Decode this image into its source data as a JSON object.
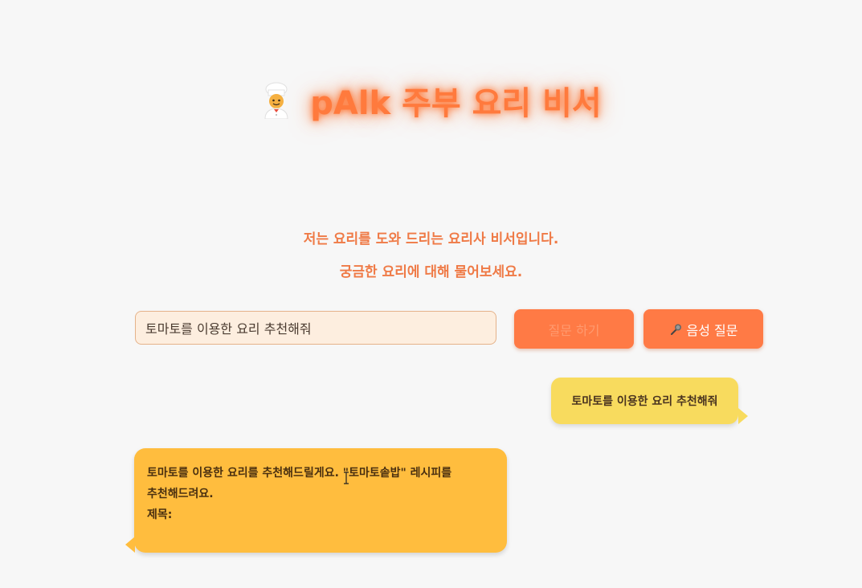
{
  "header": {
    "title": "pAlk 주부 요리 비서",
    "icon": "chef-icon"
  },
  "intro": {
    "line1": "저는 요리를 도와 드리는 요리사 비서입니다.",
    "line2": "궁금한 요리에 대해 물어보세요."
  },
  "question": {
    "value": "토마토를 이용한 요리 추천해줘"
  },
  "buttons": {
    "ask_label": "질문 하기",
    "voice_label": "음성 질문",
    "voice_icon": "microphone-icon"
  },
  "chat": {
    "user_message": "토마토를 이용한 요리 추천해줘",
    "bot_lines": [
      "토마토를 이용한 요리를 추천해드릴게요. \"토마토솥밥\" 레시피를",
      "추천해드려요.",
      "제목:"
    ]
  },
  "colors": {
    "accent": "#ff7a45",
    "title_glow": "#ff7a3d",
    "user_bubble": "#f8db5e",
    "bot_bubble": "#ffbd3e",
    "input_bg": "#fdeedf"
  }
}
